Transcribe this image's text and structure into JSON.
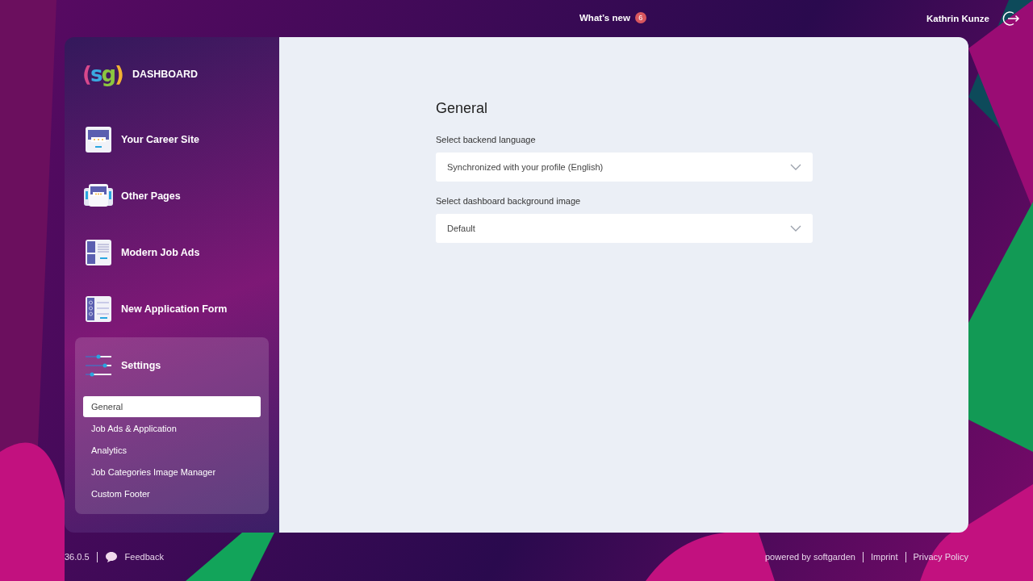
{
  "top_bar": {
    "whats_new": {
      "label": "What’s new",
      "badge": "6"
    },
    "user_name": "Kathrin Kunze"
  },
  "sidebar": {
    "logo": "(sg)",
    "title": "DASHBOARD",
    "items": [
      {
        "label": "Your Career Site",
        "kind": "career",
        "expanded": false
      },
      {
        "label": "Other Pages",
        "kind": "pages",
        "expanded": false
      },
      {
        "label": "Modern Job Ads",
        "kind": "jobads",
        "expanded": false
      },
      {
        "label": "New Application Form",
        "kind": "form",
        "expanded": false
      },
      {
        "label": "Settings",
        "kind": "settings",
        "expanded": true,
        "children": [
          {
            "label": "General",
            "selected": true
          },
          {
            "label": "Job Ads & Application",
            "selected": false
          },
          {
            "label": "Analytics",
            "selected": false
          },
          {
            "label": "Job Categories Image Manager",
            "selected": false
          },
          {
            "label": "Custom Footer",
            "selected": false
          }
        ]
      }
    ]
  },
  "main": {
    "title": "General",
    "fields": [
      {
        "label": "Select backend language",
        "value": "Synchronized with your profile (English)"
      },
      {
        "label": "Select dashboard background image",
        "value": "Default"
      }
    ]
  },
  "footer": {
    "version": "36.0.5",
    "feedback": "Feedback",
    "links": [
      "powered by softgarden",
      "Imprint",
      "Privacy Policy"
    ]
  }
}
